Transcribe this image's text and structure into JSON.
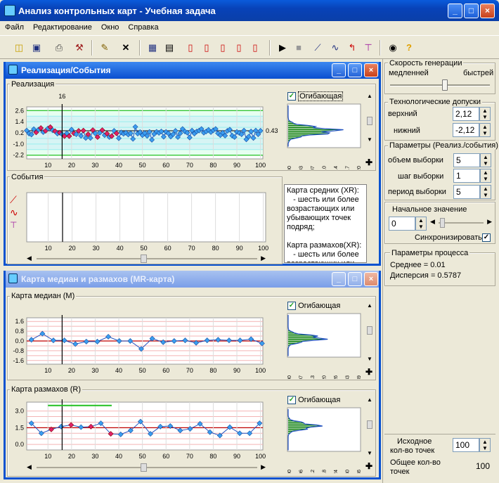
{
  "app": {
    "title": "Анализ контрольных карт - Учебная задача"
  },
  "window_buttons": {
    "minimize": "_",
    "maximize": "□",
    "close": "×"
  },
  "menu": [
    "Файл",
    "Редактирование",
    "Окно",
    "Справка"
  ],
  "realiz": {
    "title": "Реализация/События",
    "group_label": "Реализация",
    "envelope_label": "Огибающая",
    "events_label": "События",
    "current_point": "16",
    "last_value": "0.43",
    "yticks": [
      "2.6",
      "1.4",
      "0.2",
      "-1.0",
      "-2.2"
    ],
    "xticks": [
      "10",
      "20",
      "30",
      "40",
      "50",
      "60",
      "70",
      "80",
      "90",
      "100"
    ],
    "hist_ticks": [
      "0.00",
      "0.03",
      "0.07",
      "0.10",
      "0.14",
      "0.17",
      "0.20"
    ],
    "values": [
      0.45,
      0.12,
      0.02,
      0.6,
      0.25,
      0.55,
      0.72,
      0.28,
      0.42,
      0.68,
      0.82,
      0.48,
      0.38,
      0.12,
      0.22,
      0.05,
      -0.15,
      0.15,
      -0.15,
      0.55,
      0.15,
      0.05,
      0.42,
      -0.12,
      0.45,
      -0.35,
      0.05,
      -0.35,
      0.5,
      0.15,
      -0.25,
      0.22,
      0.5,
      -0.05,
      0.12,
      -0.25,
      -0.15,
      0.42,
      0.15,
      -0.38,
      0.25,
      0.1,
      0.22,
      0.02,
      0.15,
      -0.45,
      0.85,
      0.12,
      0.28,
      -0.05,
      0.18,
      -0.12,
      0.3,
      -0.55,
      0.08,
      0.32,
      0.2,
      0.35,
      -0.22,
      0.3,
      0.15,
      -0.2,
      0.05,
      0.42,
      -0.25,
      0.15,
      0.62,
      0.35,
      0.22,
      -0.3,
      0.45,
      0.12,
      0.35,
      0.45,
      0.62,
      0.22,
      0.35,
      0.52,
      0.28,
      0.48,
      0.62,
      0.15,
      -0.05,
      0.22,
      -0.1,
      0.42,
      0.55,
      -0.1,
      -0.25,
      0.3,
      0.2,
      0.05,
      0.45,
      -0.5,
      -0.2,
      0.35,
      -0.35,
      0.45,
      0.05,
      0.43
    ],
    "highlight_ranges": [
      [
        5,
        40
      ]
    ],
    "info_text": [
      "Карта средних (XR):",
      "   - шесть или более",
      "возрастающих или",
      "убывающих точек",
      "подряд;",
      "",
      "Карта размахов(XR):",
      "   - шесть или более",
      "возрастающих или"
    ]
  },
  "mr": {
    "title": "Карта медиан и размахов (MR-карта)",
    "median_label": "Карта медиан (M)",
    "range_label": "Карта размахов (R)",
    "envelope_label": "Огибающая",
    "median_yticks": [
      "1.6",
      "0.8",
      "0.0",
      "-0.8",
      "-1.6"
    ],
    "range_yticks": [
      "3.0",
      "1.5",
      "0.0"
    ],
    "xticks": [
      "10",
      "20",
      "30",
      "40",
      "50",
      "60",
      "70",
      "80",
      "90",
      "100"
    ],
    "median_hist_ticks": [
      "0.00",
      "0.07",
      "0.13",
      "0.20",
      "0.26",
      "0.33",
      "0.39"
    ],
    "range_hist_ticks": [
      "0.00",
      "0.06",
      "0.12",
      "0.18",
      "0.24",
      "0.30",
      "0.36"
    ],
    "medians": [
      0.1,
      0.6,
      0.05,
      0.05,
      -0.25,
      -0.05,
      -0.05,
      0.35,
      0.0,
      0.0,
      -0.65,
      0.2,
      -0.1,
      0.0,
      0.05,
      -0.15,
      0.05,
      0.1,
      0.05,
      0.05,
      0.15,
      -0.2
    ],
    "ranges": [
      1.9,
      1.0,
      1.35,
      1.6,
      1.75,
      1.55,
      1.6,
      1.9,
      0.95,
      0.9,
      1.25,
      2.05,
      0.95,
      1.6,
      1.65,
      1.25,
      1.4,
      1.85,
      1.1,
      0.8,
      1.55,
      1.0,
      1.0,
      1.9
    ]
  },
  "side": {
    "speed_label": "Скорость генерации",
    "speed_slow": "медленней",
    "speed_fast": "быстрей",
    "speed_level": 0.55,
    "tol_label": "Технологические допуски",
    "upper_label": "верхний",
    "upper_value": "2,12",
    "lower_label": "нижний",
    "lower_value": "-2,12",
    "params_label": "Параметры (Реализ./события)",
    "sample_size_label": "объем выборки",
    "sample_size": "5",
    "sample_step_label": "шаг  выборки",
    "sample_step": "1",
    "sample_period_label": "период  выборки",
    "sample_period": "5",
    "initial_label": "Начальное значение",
    "initial_value": "0",
    "sync_label": "Синхронизировать",
    "process_label": "Параметры процесса",
    "mean_text": "Среднее = 0.01",
    "var_text": "Дисперсия = 0.5787",
    "initial_points_label_1": "Исходное",
    "initial_points_label_2": "кол-во точек",
    "initial_points": "100",
    "total_points_label_1": "Общее кол-во",
    "total_points_label_2": "точек",
    "total_points": "100"
  }
}
